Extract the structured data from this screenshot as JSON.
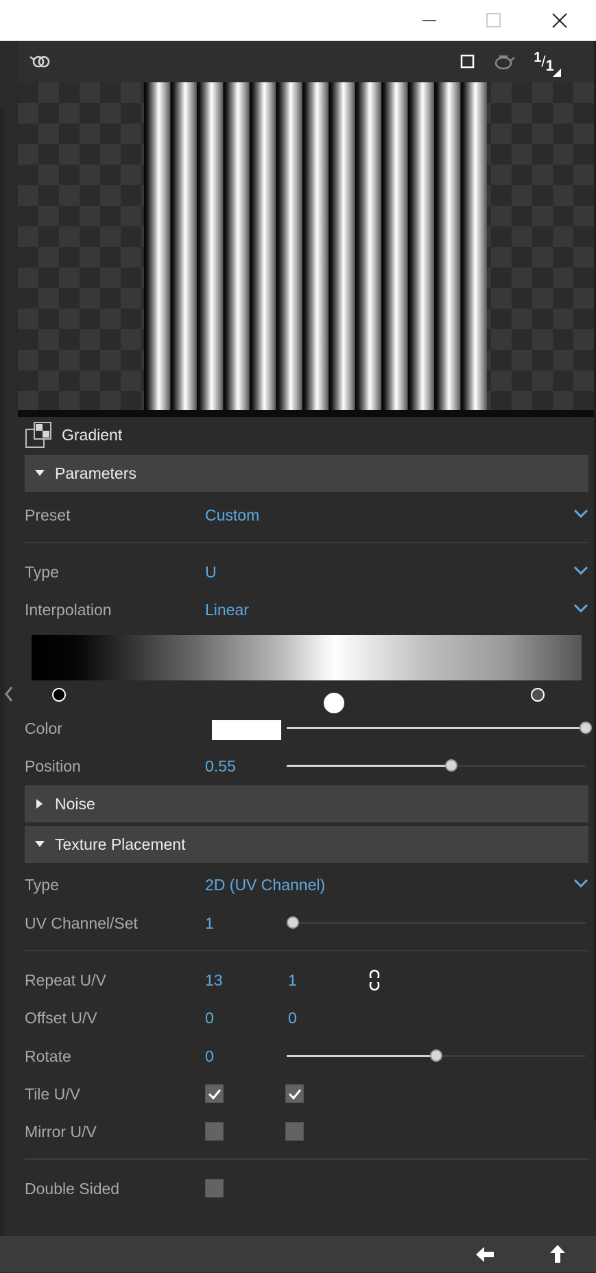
{
  "window": {
    "controls": [
      "minimize",
      "maximize",
      "close"
    ]
  },
  "viewer": {
    "toolbar_left_icon": "link-chain-icon",
    "ratio_label_top": "1",
    "ratio_label_bottom": "1"
  },
  "preview": {
    "stripes": 13
  },
  "node": {
    "title": "Gradient"
  },
  "sections": {
    "parameters": "Parameters",
    "noise": "Noise",
    "texture_placement": "Texture Placement"
  },
  "params": {
    "preset_label": "Preset",
    "preset_value": "Custom",
    "type_label": "Type",
    "type_value": "U",
    "interpolation_label": "Interpolation",
    "interpolation_value": "Linear",
    "color_label": "Color",
    "color_slider": 1.0,
    "position_label": "Position",
    "position_value": "0.55",
    "position_fraction": 0.55,
    "gradient_stops": [
      0.05,
      0.55,
      0.92
    ]
  },
  "placement": {
    "type_label": "Type",
    "type_value": "2D (UV Channel)",
    "uv_label": "UV Channel/Set",
    "uv_value": "1",
    "uv_fraction": 0.02,
    "repeat_label": "Repeat U/V",
    "repeat_u": "13",
    "repeat_v": "1",
    "offset_label": "Offset U/V",
    "offset_u": "0",
    "offset_v": "0",
    "rotate_label": "Rotate",
    "rotate_value": "0",
    "rotate_fraction": 0.5,
    "tile_label": "Tile U/V",
    "tile_u": true,
    "tile_v": true,
    "mirror_label": "Mirror U/V",
    "mirror_u": false,
    "mirror_v": false,
    "double_sided_label": "Double Sided",
    "double_sided": false
  },
  "colors": {
    "accent": "#5ea9df",
    "panel": "#2b2b2b",
    "section": "#424242"
  }
}
